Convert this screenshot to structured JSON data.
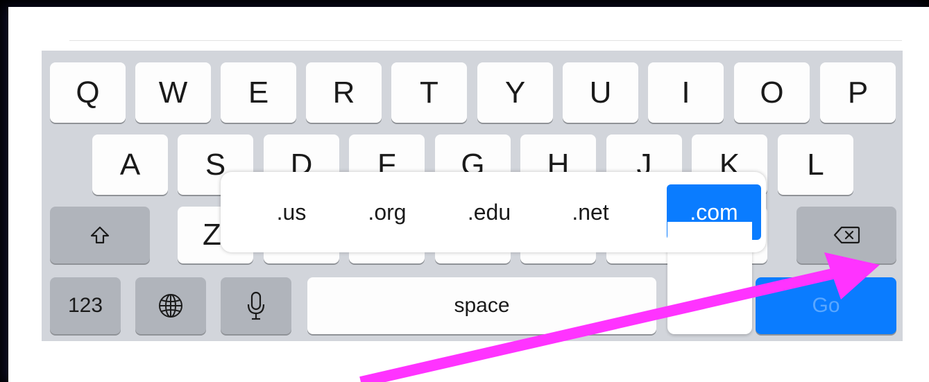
{
  "keyboard": {
    "row1": [
      "Q",
      "W",
      "E",
      "R",
      "T",
      "Y",
      "U",
      "I",
      "O",
      "P"
    ],
    "row2": [
      "A",
      "S",
      "D",
      "F",
      "G",
      "H",
      "J",
      "K",
      "L"
    ],
    "row3_partial": [
      "Z"
    ],
    "numbers_key": "123",
    "space_key": "space",
    "go_key": "Go",
    "icons": {
      "shift": "shift-icon",
      "globe": "globe-icon",
      "mic": "microphone-icon",
      "backspace": "backspace-icon"
    },
    "colors": {
      "background": "#d2d5db",
      "key": "#fdfdfd",
      "modifier_key": "#b0b4bb",
      "accent": "#0a7cff"
    }
  },
  "domain_popup": {
    "options": [
      ".us",
      ".org",
      ".edu",
      ".net",
      ".com"
    ],
    "selected": ".com"
  },
  "annotation": {
    "arrow_color": "#ff33ff"
  }
}
